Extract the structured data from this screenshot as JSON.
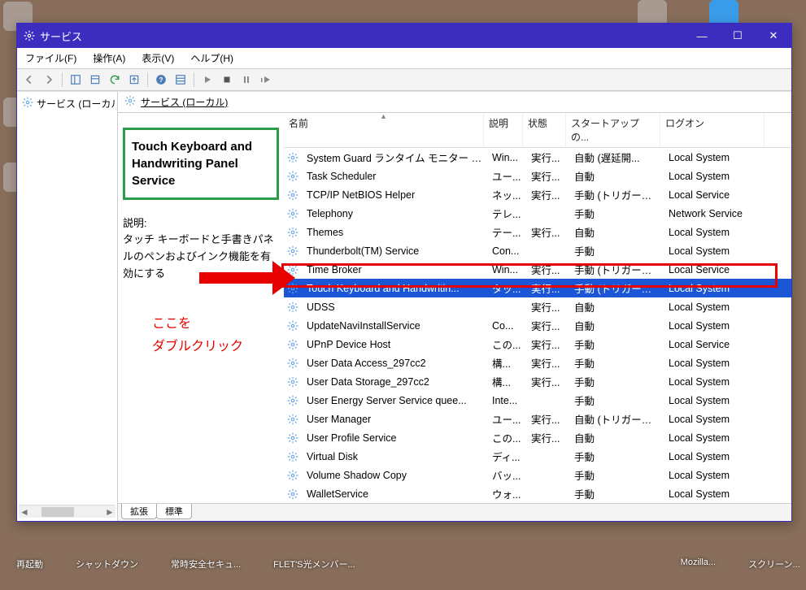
{
  "window": {
    "title": "サービス",
    "controls": {
      "minimize": "—",
      "maximize": "☐",
      "close": "✕"
    }
  },
  "menu": {
    "file": "ファイル(F)",
    "action": "操作(A)",
    "view": "表示(V)",
    "help": "ヘルプ(H)"
  },
  "tree": {
    "root": "サービス (ローカル"
  },
  "detail": {
    "header": "サービス (ローカル)",
    "selected_title": "Touch Keyboard and Handwriting Panel Service",
    "desc_label": "説明:",
    "desc_text": "タッチ キーボードと手書きパネルのペンおよびインク機能を有効にする",
    "annotation_line1": "ここを",
    "annotation_line2": "ダブルクリック"
  },
  "columns": {
    "name": "名前",
    "desc": "説明",
    "status": "状態",
    "startup": "スタートアップの...",
    "logon": "ログオン"
  },
  "services": [
    {
      "name": "System Guard ランタイム モニター ブ...",
      "desc": "Win...",
      "status": "実行...",
      "startup": "自動 (遅延開...",
      "logon": "Local System",
      "sel": false
    },
    {
      "name": "Task Scheduler",
      "desc": "ユー...",
      "status": "実行...",
      "startup": "自動",
      "logon": "Local System",
      "sel": false
    },
    {
      "name": "TCP/IP NetBIOS Helper",
      "desc": "ネッ...",
      "status": "実行...",
      "startup": "手動 (トリガー開...",
      "logon": "Local Service",
      "sel": false
    },
    {
      "name": "Telephony",
      "desc": "テレ...",
      "status": "",
      "startup": "手動",
      "logon": "Network Service",
      "sel": false
    },
    {
      "name": "Themes",
      "desc": "テー...",
      "status": "実行...",
      "startup": "自動",
      "logon": "Local System",
      "sel": false
    },
    {
      "name": "Thunderbolt(TM) Service",
      "desc": "Con...",
      "status": "",
      "startup": "手動",
      "logon": "Local System",
      "sel": false
    },
    {
      "name": "Time Broker",
      "desc": "Win...",
      "status": "実行...",
      "startup": "手動 (トリガー開...",
      "logon": "Local Service",
      "sel": false
    },
    {
      "name": "Touch Keyboard and Handwritin...",
      "desc": "タッ...",
      "status": "実行...",
      "startup": "手動 (トリガー開...",
      "logon": "Local System",
      "sel": true
    },
    {
      "name": "UDSS",
      "desc": "",
      "status": "実行...",
      "startup": "自動",
      "logon": "Local System",
      "sel": false
    },
    {
      "name": "UpdateNaviInstallService",
      "desc": "Co...",
      "status": "実行...",
      "startup": "自動",
      "logon": "Local System",
      "sel": false
    },
    {
      "name": "UPnP Device Host",
      "desc": "この...",
      "status": "実行...",
      "startup": "手動",
      "logon": "Local Service",
      "sel": false
    },
    {
      "name": "User Data Access_297cc2",
      "desc": "構...",
      "status": "実行...",
      "startup": "手動",
      "logon": "Local System",
      "sel": false
    },
    {
      "name": "User Data Storage_297cc2",
      "desc": "構...",
      "status": "実行...",
      "startup": "手動",
      "logon": "Local System",
      "sel": false
    },
    {
      "name": "User Energy Server Service quee...",
      "desc": "Inte...",
      "status": "",
      "startup": "手動",
      "logon": "Local System",
      "sel": false
    },
    {
      "name": "User Manager",
      "desc": "ユー...",
      "status": "実行...",
      "startup": "自動 (トリガー開...",
      "logon": "Local System",
      "sel": false
    },
    {
      "name": "User Profile Service",
      "desc": "この...",
      "status": "実行...",
      "startup": "自動",
      "logon": "Local System",
      "sel": false
    },
    {
      "name": "Virtual Disk",
      "desc": "ディ...",
      "status": "",
      "startup": "手動",
      "logon": "Local System",
      "sel": false
    },
    {
      "name": "Volume Shadow Copy",
      "desc": "バッ...",
      "status": "",
      "startup": "手動",
      "logon": "Local System",
      "sel": false
    },
    {
      "name": "WalletService",
      "desc": "ウォ...",
      "status": "",
      "startup": "手動",
      "logon": "Local System",
      "sel": false
    }
  ],
  "tabs": {
    "ext": "拡張",
    "std": "標準"
  },
  "taskbar": {
    "i0": "再起動",
    "i1": "シャットダウン",
    "i2": "常時安全セキュ...",
    "i3": "FLET'S光メンバー...",
    "i4": "Mozilla...",
    "i5": "スクリーン..."
  }
}
